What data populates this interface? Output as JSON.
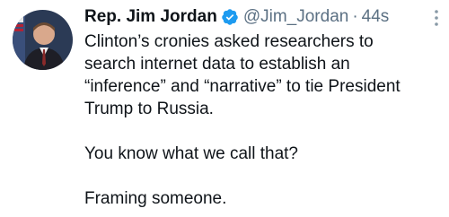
{
  "tweet": {
    "author_name": "Rep. Jim Jordan",
    "handle": "@Jim_Jordan",
    "separator": "·",
    "timestamp": "44s",
    "verified_icon": "verified-badge-icon",
    "more_icon": "more-options-icon",
    "accent_color": "#1d9bf0",
    "paragraphs": [
      "Clinton’s cronies asked researchers to search internet data to establish an “inference” and “narrative” to tie President Trump to Russia.",
      "You know what we call that?",
      "Framing someone."
    ]
  }
}
